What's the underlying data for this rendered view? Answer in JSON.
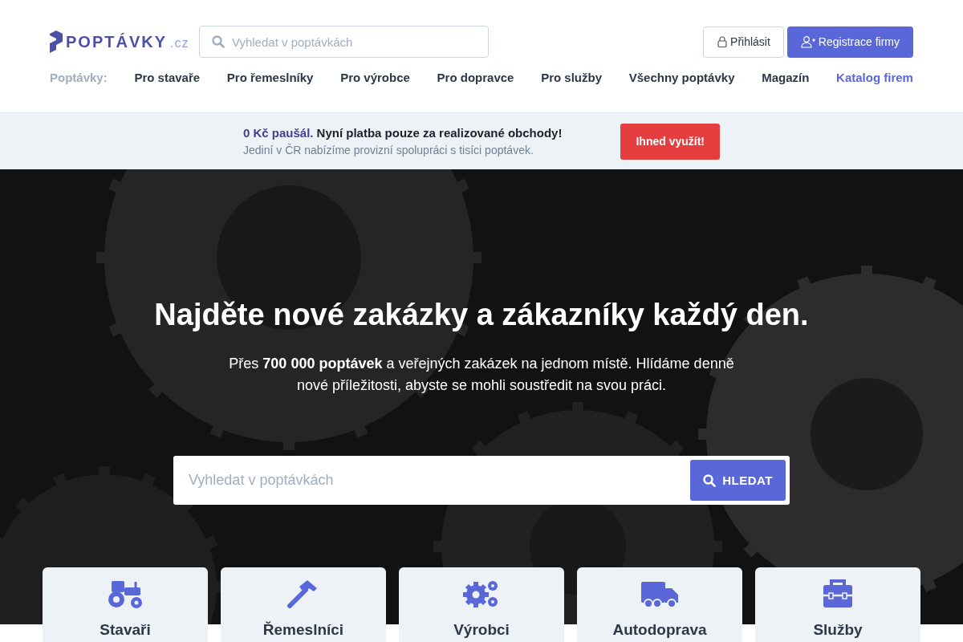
{
  "header": {
    "logo": {
      "name": "POPTÁVKY",
      "tld": ".cz"
    },
    "search": {
      "placeholder": "Vyhledat v poptávkách"
    },
    "login_button": "Přihlásit",
    "register_button": "Registrace firmy"
  },
  "nav": {
    "label": "Poptávky:",
    "items": [
      {
        "label": "Pro stavaře",
        "kind": "plain"
      },
      {
        "label": "Pro řemeslníky",
        "kind": "plain"
      },
      {
        "label": "Pro výrobce",
        "kind": "plain"
      },
      {
        "label": "Pro dopravce",
        "kind": "plain"
      },
      {
        "label": "Pro služby",
        "kind": "plain"
      },
      {
        "label": "Všechny poptávky",
        "kind": "plain"
      },
      {
        "label": "Magazín",
        "kind": "plain"
      },
      {
        "label": "Katalog firem",
        "kind": "accent"
      }
    ]
  },
  "promo": {
    "highlight": "0 Kč paušál.",
    "headline": "Nyní platba pouze za realizované obchody!",
    "subtext": "Jediní v ČR nabízíme provizní spolupráci s tisíci poptávek.",
    "button": "Ihned využít!"
  },
  "hero": {
    "title": "Najděte nové zakázky a zákazníky každý den.",
    "text": "Přes **700 000 poptávek** a veřejných zakázek na jednom místě. Hlídáme denně nové příležitosti, abyste se mohli soustředit na svou práci.",
    "search": {
      "placeholder": "Vyhledat v poptávkách"
    },
    "search_button": "HLEDAT"
  },
  "categories": [
    {
      "label": "Stavaři",
      "kind": "tractor"
    },
    {
      "label": "Řemeslníci",
      "kind": "hammer"
    },
    {
      "label": "Výrobci",
      "kind": "gears"
    },
    {
      "label": "Autodoprava",
      "kind": "truck"
    },
    {
      "label": "Služby",
      "kind": "toolbox"
    }
  ]
}
